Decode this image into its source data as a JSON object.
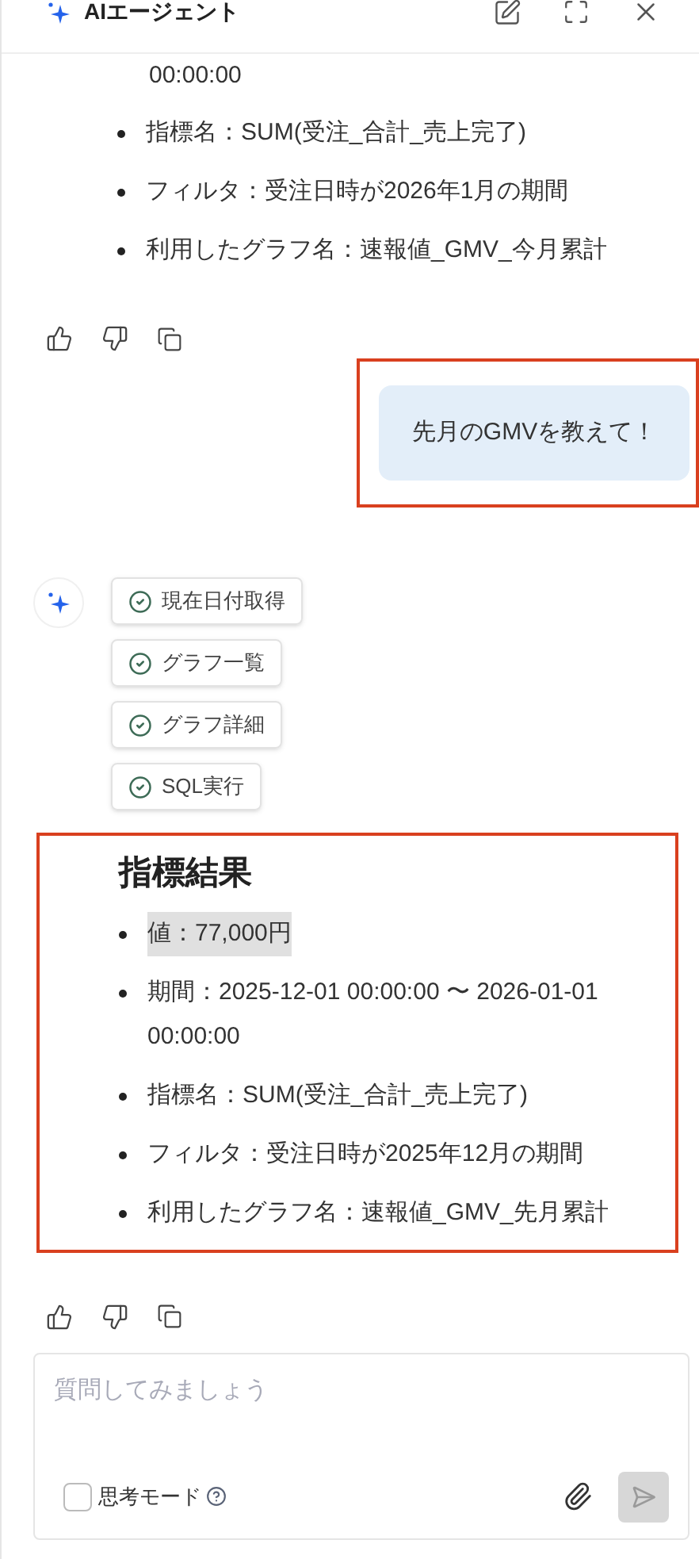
{
  "header": {
    "title": "AIエージェント"
  },
  "previous_answer": {
    "items": [
      {
        "text": "00:00:00",
        "kind": "continuation",
        "highlighted": false
      },
      {
        "text": "指標名：SUM(受注_合計_売上完了)",
        "kind": "bullet",
        "highlighted": false
      },
      {
        "text": "フィルタ：受注日時が2026年1月の期間",
        "kind": "bullet",
        "highlighted": false
      },
      {
        "text": "利用したグラフ名：速報値_GMV_今月累計",
        "kind": "bullet",
        "highlighted": false
      }
    ]
  },
  "user_message": {
    "text": "先月のGMVを教えて！"
  },
  "tool_steps": [
    {
      "label": "現在日付取得",
      "done": true
    },
    {
      "label": "グラフ一覧",
      "done": true
    },
    {
      "label": "グラフ詳細",
      "done": true
    },
    {
      "label": "SQL実行",
      "done": true
    }
  ],
  "answer": {
    "heading": "指標結果",
    "items": [
      {
        "text": "値：77,000円",
        "kind": "bullet",
        "highlighted": true
      },
      {
        "text": "期間：2025-12-01 00:00:00 〜 2026-01-01 00:00:00",
        "kind": "bullet",
        "highlighted": false
      },
      {
        "text": "指標名：SUM(受注_合計_売上完了)",
        "kind": "bullet",
        "highlighted": false
      },
      {
        "text": "フィルタ：受注日時が2025年12月の期間",
        "kind": "bullet",
        "highlighted": false
      },
      {
        "text": "利用したグラフ名：速報値_GMV_先月累計",
        "kind": "bullet",
        "highlighted": false
      }
    ]
  },
  "composer": {
    "placeholder": "質問してみましょう",
    "thinking_mode": {
      "label": "思考モード",
      "checked": false
    }
  }
}
